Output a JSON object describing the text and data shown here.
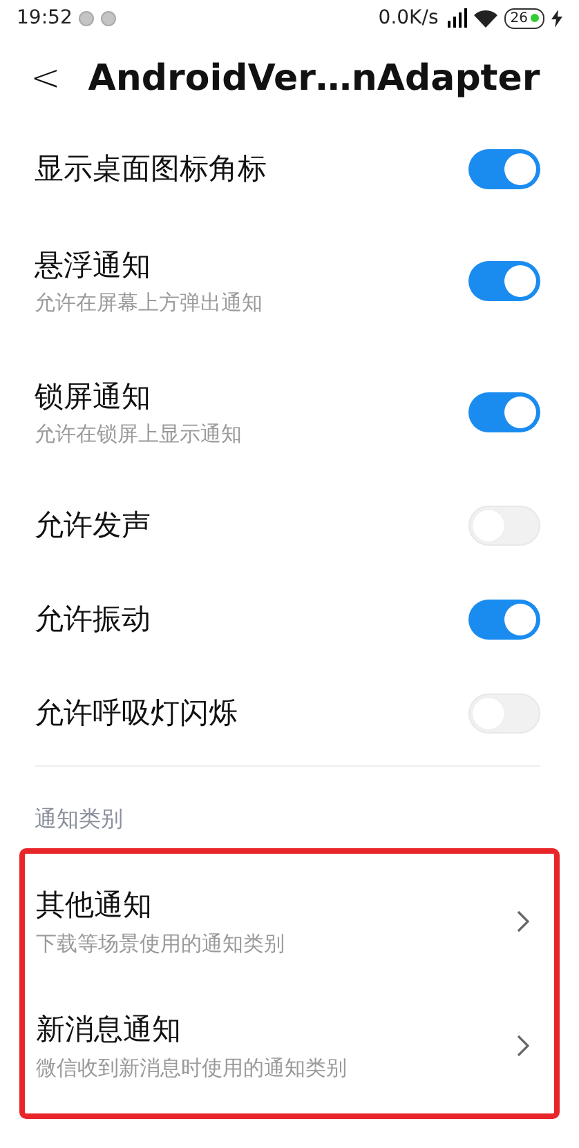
{
  "status_bar": {
    "time": "19:52",
    "speed": "0.0K/s",
    "battery": "26",
    "charging": true
  },
  "title_bar": {
    "back": "<",
    "title": "AndroidVer…nAdapter"
  },
  "settings": [
    {
      "title": "显示桌面图标角标",
      "on": true
    },
    {
      "title": "悬浮通知",
      "subtitle": "允许在屏幕上方弹出通知",
      "on": true
    },
    {
      "title": "锁屏通知",
      "subtitle": "允许在锁屏上显示通知",
      "on": true
    },
    {
      "title": "允许发声",
      "on": false
    },
    {
      "title": "允许振动",
      "on": true
    },
    {
      "title": "允许呼吸灯闪烁",
      "on": false
    }
  ],
  "category_section": {
    "header": "通知类别",
    "highlighted": true,
    "items": [
      {
        "title": "其他通知",
        "subtitle": "下载等场景使用的通知类别"
      },
      {
        "title": "新消息通知",
        "subtitle": "微信收到新消息时使用的通知类别"
      }
    ]
  }
}
